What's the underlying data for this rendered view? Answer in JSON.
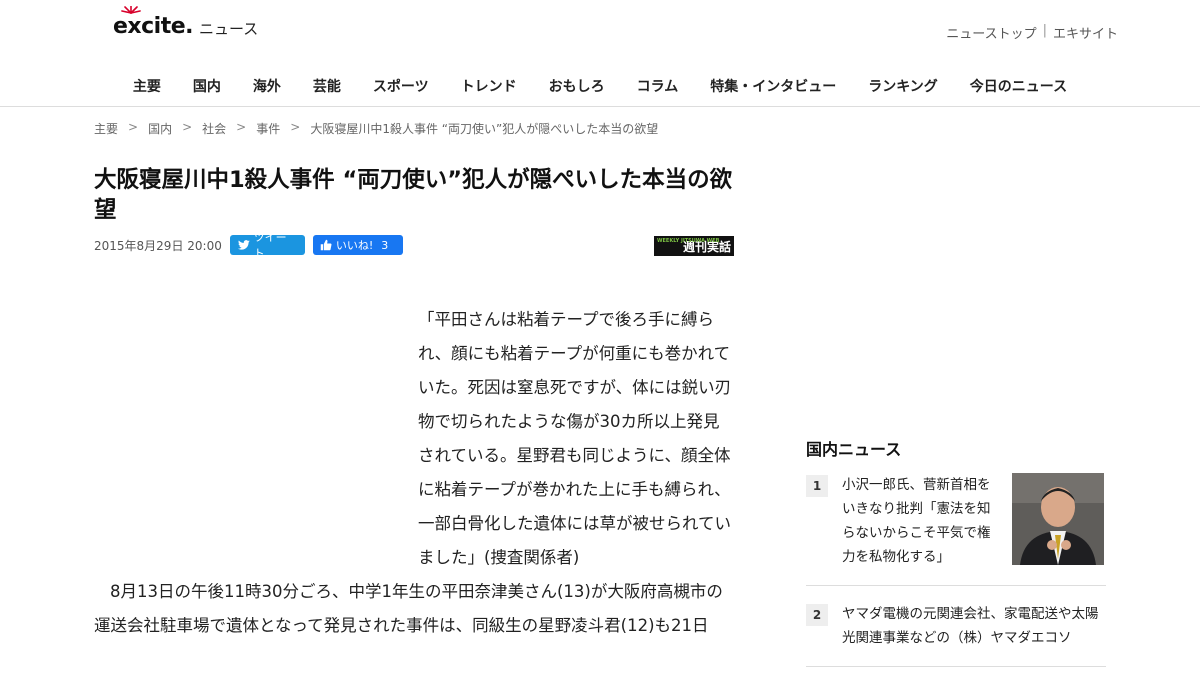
{
  "header": {
    "logo_text": "excite",
    "logo_dot": ".",
    "logo_section": "ニュース",
    "top_links": [
      "ニューストップ",
      "エキサイト"
    ],
    "top_links_sep": "|"
  },
  "nav": {
    "items": [
      "主要",
      "国内",
      "海外",
      "芸能",
      "スポーツ",
      "トレンド",
      "おもしろ",
      "コラム",
      "特集・インタビュー",
      "ランキング",
      "今日のニュース"
    ]
  },
  "breadcrumb": {
    "items": [
      "主要",
      "国内",
      "社会",
      "事件",
      "大阪寝屋川中1殺人事件 “両刀使い”犯人が隠ぺいした本当の欲望"
    ],
    "separator": ">"
  },
  "article": {
    "title": "大阪寝屋川中1殺人事件 “両刀使い”犯人が隠ぺいした本当の欲望",
    "date": "2015年8月29日 20:00",
    "tweet_label": "ツイート",
    "like_label": "いいね!",
    "like_count": "3",
    "source_name": "週刊実話",
    "source_small": "WEEKLY JITSUWA WEB",
    "quote": "「平田さんは粘着テープで後ろ手に縛られ、顔にも粘着テープが何重にも巻かれていた。死因は窒息死ですが、体には鋭い刃物で切られたような傷が30カ所以上発見されている。星野君も同じように、顔全体に粘着テープが巻かれた上に手も縛られ、一部白骨化した遺体には草が被せられていました」(捜査関係者)",
    "body": "8月13日の午後11時30分ごろ、中学1年生の平田奈津美さん(13)が大阪府高槻市の運送会社駐車場で遺体となって発見された事件は、同級生の星野凌斗君(12)も21日"
  },
  "sidebar": {
    "heading": "国内ニュース",
    "items": [
      {
        "rank": "1",
        "text": "小沢一郎氏、菅新首相をいきなり批判「憲法を知らないからこそ平気で権力を私物化する」"
      },
      {
        "rank": "2",
        "text": "ヤマダ電機の元関連会社、家電配送や太陽光関連事業などの（株）ヤマダエコソ"
      }
    ]
  },
  "colors": {
    "twitter": "#1b95e0",
    "facebook": "#1877f2",
    "logo_red": "#d7002b"
  }
}
